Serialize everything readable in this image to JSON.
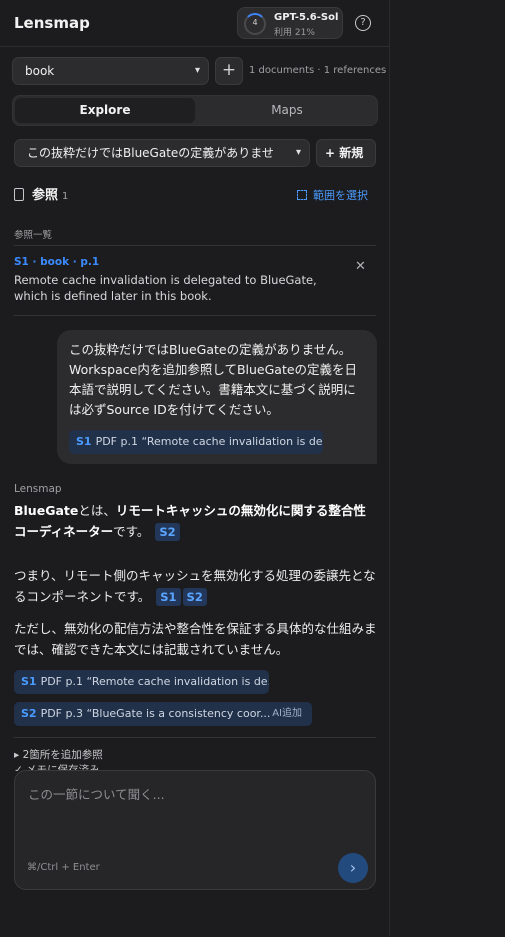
{
  "header": {
    "app_title": "Lensmap",
    "model": {
      "ring_number": "4",
      "name": "GPT-5.6-Sol",
      "usage": "利用 21%"
    },
    "help_glyph": "?"
  },
  "toolbar": {
    "book_select_value": "book",
    "plus_glyph": "+",
    "doc_counts": "1 documents · 1 references"
  },
  "tabs": [
    {
      "label": "Explore",
      "active": true
    },
    {
      "label": "Maps",
      "active": false
    }
  ],
  "question_bar": {
    "select_value": "この抜粋だけではBlueGateの定義がありませ",
    "new_button": "+ 新規"
  },
  "references": {
    "title": "参照",
    "count": "1",
    "select_range": "範囲を選択",
    "list_label": "参照一覧",
    "items": [
      {
        "id": "S1 · book · p.1",
        "text": "Remote cache invalidation is delegated to BlueGate, which is defined later in this book."
      }
    ],
    "close_glyph": "✕"
  },
  "user_message": {
    "text": "この抜粋だけではBlueGateの定義がありません。Workspace内を追加参照してBlueGateの定義を日本語で説明してください。書籍本文に基づく説明には必ずSource IDを付けてください。",
    "citation": {
      "sid": "S1",
      "text": "PDF p.1 “Remote cache invalidation is de..."
    }
  },
  "assistant_message": {
    "label": "Lensmap",
    "p1_a": "BlueGate",
    "p1_b": "とは、",
    "p1_c": "リモートキャッシュの無効化に関する整合性コーディネーター",
    "p1_d": "です。",
    "p1_badge": "S2",
    "p2_text": "つまり、リモート側のキャッシュを無効化する処理の委譲先となるコンポーネントです。",
    "p2_badges": [
      "S1",
      "S2"
    ],
    "p3_text": "ただし、無効化の配信方法や整合性を保証する具体的な仕組みまでは、確認できた本文には記載されていません。",
    "citations": [
      {
        "sid": "S1",
        "text": "PDF p.1 “Remote cache invalidation is de...",
        "tag": ""
      },
      {
        "sid": "S2",
        "text": "PDF p.3 “BlueGate is a consistency coor...",
        "tag": "AI追加"
      }
    ]
  },
  "footer": {
    "more_refs": "▸ 2箇所を追加参照",
    "saved": "✓ メモに保存済み"
  },
  "composer": {
    "placeholder": "この一節について聞く...",
    "shortcut": "⌘/Ctrl + Enter",
    "send_glyph": "›"
  },
  "colors": {
    "accent": "#3b82f6",
    "background": "#1c1c1e",
    "surface": "#2c2c2e"
  }
}
